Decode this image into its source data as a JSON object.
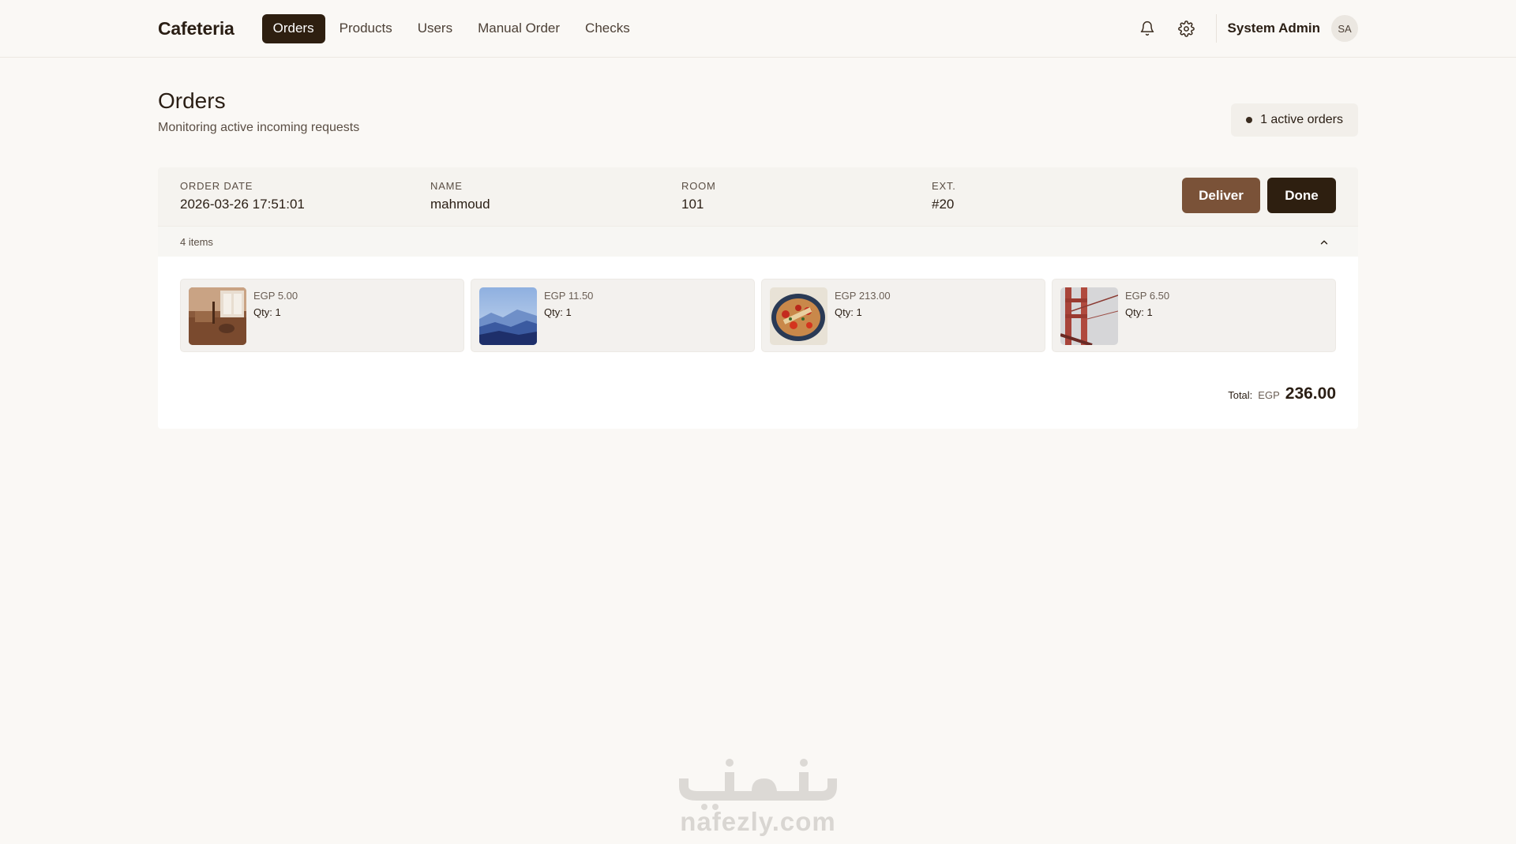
{
  "header": {
    "brand": "Cafeteria",
    "nav": [
      {
        "label": "Orders",
        "active": true
      },
      {
        "label": "Products",
        "active": false
      },
      {
        "label": "Users",
        "active": false
      },
      {
        "label": "Manual Order",
        "active": false
      },
      {
        "label": "Checks",
        "active": false
      }
    ],
    "icons": {
      "notifications": "bell-icon",
      "settings": "gear-icon"
    },
    "user": {
      "name": "System Admin",
      "initials": "SA"
    }
  },
  "page": {
    "title": "Orders",
    "subtitle": "Monitoring active incoming requests",
    "active_badge": "1 active orders"
  },
  "order": {
    "fields": [
      {
        "label": "ORDER DATE",
        "value": "2026-03-26 17:51:01"
      },
      {
        "label": "NAME",
        "value": "mahmoud"
      },
      {
        "label": "ROOM",
        "value": "101"
      },
      {
        "label": "EXT.",
        "value": "#20"
      }
    ],
    "actions": {
      "deliver": "Deliver",
      "done": "Done"
    },
    "items_count": "4 items",
    "items": [
      {
        "price": "EGP 5.00",
        "qty": "Qty: 1",
        "image": "interior-photo"
      },
      {
        "price": "EGP 11.50",
        "qty": "Qty: 1",
        "image": "mountain-mist-photo"
      },
      {
        "price": "EGP 213.00",
        "qty": "Qty: 1",
        "image": "food-dish-photo"
      },
      {
        "price": "EGP 6.50",
        "qty": "Qty: 1",
        "image": "bridge-photo"
      }
    ],
    "total": {
      "label": "Total:",
      "currency": "EGP",
      "value": "236.00"
    }
  },
  "watermark": {
    "arabic": "نفذلي",
    "latin": "nafezly.com"
  },
  "colors": {
    "background": "#faf8f5",
    "primary_dark": "#2e1f10",
    "deliver_brown": "#7a5238",
    "card_header": "#f5f3ef"
  }
}
